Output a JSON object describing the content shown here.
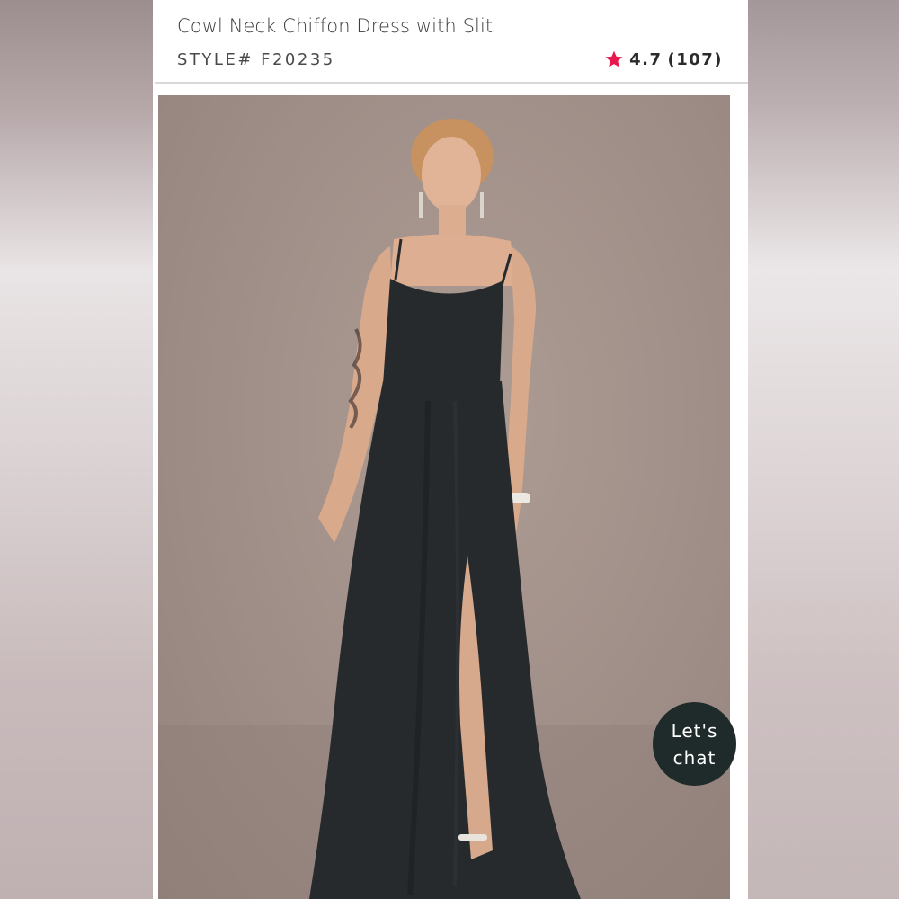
{
  "product": {
    "title": "Cowl Neck Chiffon Dress with Slit",
    "style_number": "STYLE# F20235",
    "rating": {
      "score": "4.7",
      "count": "(107)",
      "icon": "star-icon",
      "star_color": "#e8174d"
    },
    "image": {
      "subject": "model-in-black-cowl-neck-gown",
      "dress_color": "#262a2c"
    }
  },
  "chat": {
    "line1": "Let's",
    "line2": "chat",
    "bg_color": "#1e2b2a"
  }
}
